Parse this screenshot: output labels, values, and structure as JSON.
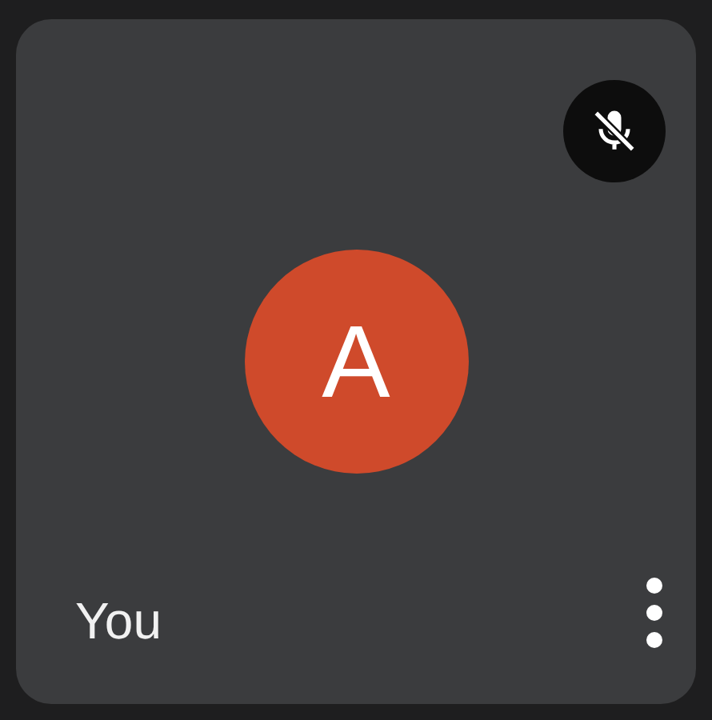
{
  "tile": {
    "initial": "A",
    "name": "You",
    "muted": true
  }
}
